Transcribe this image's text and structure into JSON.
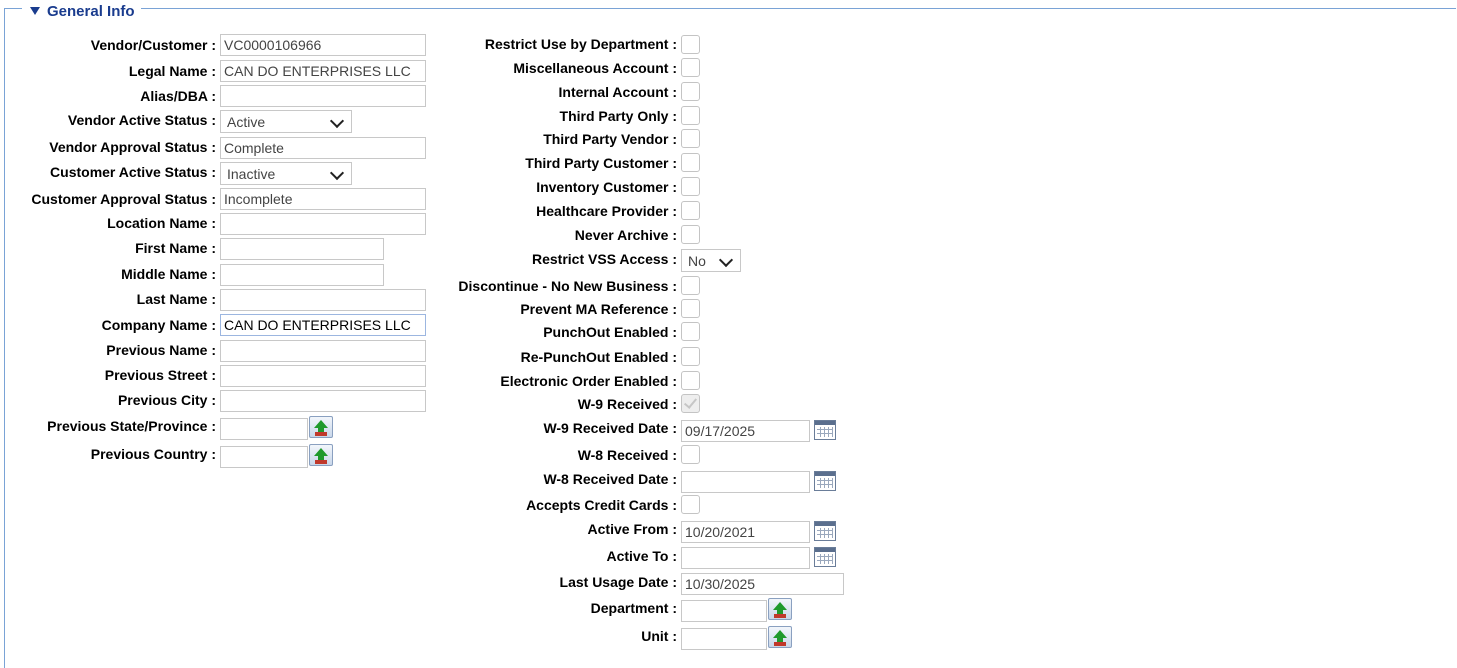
{
  "section": {
    "title": "General Info"
  },
  "left": {
    "vendor_customer": {
      "label": "Vendor/Customer :",
      "value": "VC0000106966"
    },
    "legal_name": {
      "label": "Legal Name :",
      "value": "CAN DO ENTERPRISES LLC"
    },
    "alias_dba": {
      "label": "Alias/DBA :",
      "value": ""
    },
    "vendor_active_status": {
      "label": "Vendor Active Status :",
      "value": "Active"
    },
    "vendor_approval_status": {
      "label": "Vendor Approval Status :",
      "value": "Complete"
    },
    "customer_active_status": {
      "label": "Customer Active Status :",
      "value": "Inactive"
    },
    "customer_approval_status": {
      "label": "Customer Approval Status :",
      "value": "Incomplete"
    },
    "location_name": {
      "label": "Location Name :",
      "value": ""
    },
    "first_name": {
      "label": "First Name :",
      "value": ""
    },
    "middle_name": {
      "label": "Middle Name :",
      "value": ""
    },
    "last_name": {
      "label": "Last Name :",
      "value": ""
    },
    "company_name": {
      "label": "Company Name :",
      "value": "CAN DO ENTERPRISES LLC"
    },
    "previous_name": {
      "label": "Previous Name :",
      "value": ""
    },
    "previous_street": {
      "label": "Previous Street :",
      "value": ""
    },
    "previous_city": {
      "label": "Previous City :",
      "value": ""
    },
    "previous_state": {
      "label": "Previous State/Province :",
      "value": ""
    },
    "previous_country": {
      "label": "Previous Country :",
      "value": ""
    }
  },
  "right": {
    "restrict_use_dept": {
      "label": "Restrict Use by Department :",
      "checked": false
    },
    "misc_account": {
      "label": "Miscellaneous Account :",
      "checked": false
    },
    "internal_account": {
      "label": "Internal Account :",
      "checked": false
    },
    "third_party_only": {
      "label": "Third Party Only :",
      "checked": false
    },
    "third_party_vendor": {
      "label": "Third Party Vendor :",
      "checked": false
    },
    "third_party_customer": {
      "label": "Third Party Customer :",
      "checked": false
    },
    "inventory_customer": {
      "label": "Inventory Customer :",
      "checked": false
    },
    "healthcare_provider": {
      "label": "Healthcare Provider :",
      "checked": false
    },
    "never_archive": {
      "label": "Never Archive :",
      "checked": false
    },
    "restrict_vss_access": {
      "label": "Restrict VSS Access :",
      "value": "No"
    },
    "discontinue": {
      "label": "Discontinue - No New Business :",
      "checked": false
    },
    "prevent_ma_reference": {
      "label": "Prevent MA Reference :",
      "checked": false
    },
    "punchout_enabled": {
      "label": "PunchOut Enabled :",
      "checked": false
    },
    "repunchout_enabled": {
      "label": "Re-PunchOut Enabled :",
      "checked": false
    },
    "electronic_order_enabled": {
      "label": "Electronic Order Enabled :",
      "checked": false
    },
    "w9_received": {
      "label": "W-9 Received :",
      "checked": true
    },
    "w9_received_date": {
      "label": "W-9 Received Date :",
      "value": "09/17/2025"
    },
    "w8_received": {
      "label": "W-8 Received :",
      "checked": false
    },
    "w8_received_date": {
      "label": "W-8 Received Date :",
      "value": ""
    },
    "accepts_credit_cards": {
      "label": "Accepts Credit Cards :",
      "checked": false
    },
    "active_from": {
      "label": "Active From :",
      "value": "10/20/2021"
    },
    "active_to": {
      "label": "Active To :",
      "value": ""
    },
    "last_usage_date": {
      "label": "Last Usage Date :",
      "value": "10/30/2025"
    },
    "department": {
      "label": "Department :",
      "value": ""
    },
    "unit": {
      "label": "Unit :",
      "value": ""
    }
  },
  "icons": {
    "lookup": "lookup-arrow-icon",
    "calendar": "calendar-icon",
    "section_toggle": "triangle-down-icon"
  }
}
